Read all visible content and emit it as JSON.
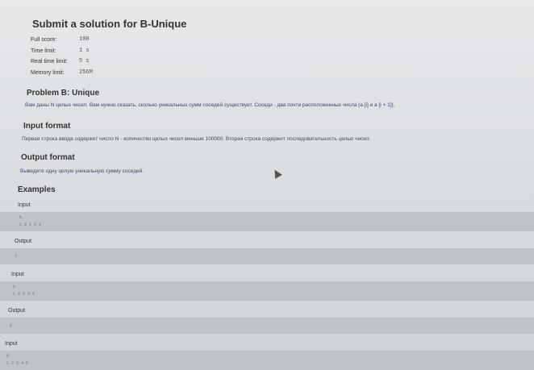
{
  "page": {
    "title": "Submit a solution for B-Unique"
  },
  "limits": {
    "full_score": {
      "label": "Full score:",
      "value": "100"
    },
    "time_limit": {
      "label": "Time limit:",
      "value": "1 s"
    },
    "real_time_limit": {
      "label": "Real time limit:",
      "value": "5 s"
    },
    "memory_limit": {
      "label": "Memory limit:",
      "value": "256M"
    }
  },
  "problem": {
    "heading": "Problem B: Unique",
    "statement": "Вам даны N целых чисел. Вам нужно сказать, сколько уникальных сумм соседей существует. Соседи - два почти расположенных числа (a [i] и a [i + 1]).",
    "input_heading": "Input format",
    "input_text": "Первая строка ввода содержит число N - количество целых чисел меньше 100000. Вторая строка содержит последовательность целых чисел.",
    "output_heading": "Output format",
    "output_text": "Выведите одну целую уникальную сумму соседей."
  },
  "examples": {
    "heading": "Examples",
    "input_label": "Input",
    "output_label": "Output",
    "ex1_input_line1": "5",
    "ex1_input_line2": "1 2 1 2 1",
    "ex1_output": "1",
    "ex2_input_line1": "5",
    "ex2_input_line2": "1 2 3 2 1",
    "ex2_output": "2",
    "ex3_input_line1": "5",
    "ex3_input_line2": "1 2 3 4 5"
  }
}
